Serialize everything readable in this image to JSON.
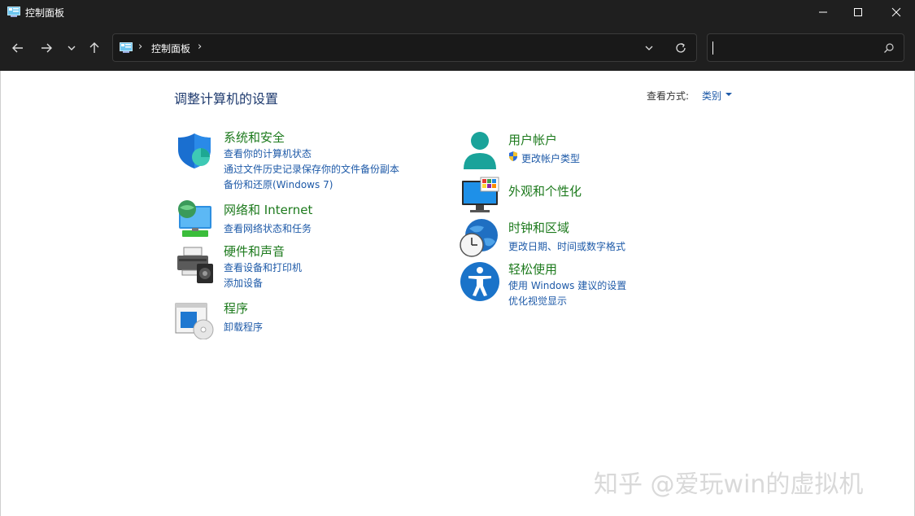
{
  "window": {
    "title": "控制面板"
  },
  "address": {
    "crumb": "控制面板",
    "sep": "›"
  },
  "search": {
    "placeholder": ""
  },
  "main": {
    "title": "调整计算机的设置",
    "view_by_label": "查看方式:",
    "view_by_value": "类别"
  },
  "left_categories": [
    {
      "title": "系统和安全",
      "icon": "shield-icon",
      "links": [
        "查看你的计算机状态",
        "通过文件历史记录保存你的文件备份副本",
        "备份和还原(Windows 7)"
      ]
    },
    {
      "title": "网络和 Internet",
      "icon": "network-globe-icon",
      "links": [
        "查看网络状态和任务"
      ]
    },
    {
      "title": "硬件和声音",
      "icon": "printer-speaker-icon",
      "links": [
        "查看设备和打印机",
        "添加设备"
      ]
    },
    {
      "title": "程序",
      "icon": "programs-disc-icon",
      "links": [
        "卸载程序"
      ]
    }
  ],
  "right_categories": [
    {
      "title": "用户帐户",
      "icon": "user-icon",
      "links": [
        "更改帐户类型"
      ]
    },
    {
      "title": "外观和个性化",
      "icon": "monitor-personalize-icon",
      "links": []
    },
    {
      "title": "时钟和区域",
      "icon": "clock-globe-icon",
      "links": [
        "更改日期、时间或数字格式"
      ]
    },
    {
      "title": "轻松使用",
      "icon": "accessibility-icon",
      "links": [
        "使用 Windows 建议的设置",
        "优化视觉显示"
      ]
    }
  ],
  "watermark": "知乎 @爱玩win的虚拟机",
  "colors": {
    "titlebar": "#1f1f1f",
    "category_title": "#1d7a1d",
    "link": "#1e5aa8",
    "heading": "#1e3a6e"
  }
}
